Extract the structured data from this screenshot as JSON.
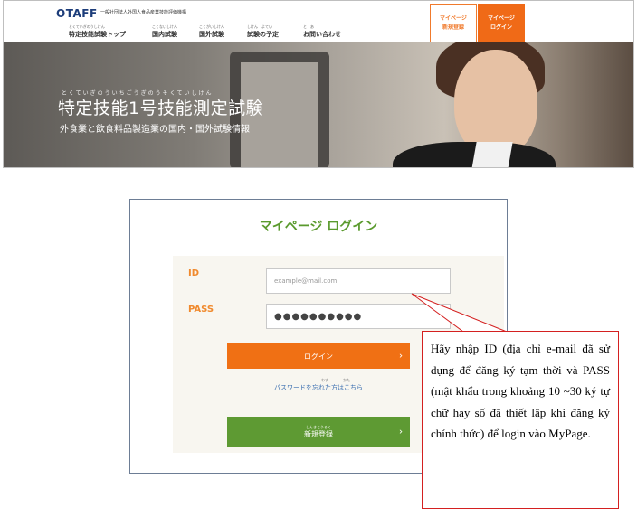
{
  "header": {
    "logo": "OTAFF",
    "org": "一般社団法人外国人食品産業技能評価機構",
    "nav": [
      {
        "ruby": "とくていぎのうしけん",
        "label": "特定技能試験トップ"
      },
      {
        "ruby": "こくないしけん",
        "label": "国内試験"
      },
      {
        "ruby": "こくがいしけん",
        "label": "国外試験"
      },
      {
        "ruby": "しけん　よてい",
        "label": "試験の予定"
      },
      {
        "ruby": "と　あ",
        "label": "お問い合わせ"
      }
    ],
    "register_button": [
      "マイページ",
      "新規登録"
    ],
    "login_button": [
      "マイページ",
      "ログイン"
    ]
  },
  "hero": {
    "ruby": "とくていぎのういちごうぎのうそくていしけん",
    "title": "特定技能1号技能測定試験",
    "subtitle": "外食業と飲食料品製造業の国内・国外試験情報"
  },
  "login": {
    "title": "マイページ ログイン",
    "id_label": "ID",
    "id_placeholder": "example@mail.com",
    "pass_label": "PASS",
    "pass_value": "●●●●●●●●●●",
    "login_button": "ログイン",
    "forgot_ruby": "わす　　　　かた",
    "forgot_link": "パスワードを忘れた方はこちら",
    "register_ruby": "しんきとうろく",
    "register_button": "新規登録",
    "chevron": "›"
  },
  "callout": {
    "text": "Hãy nhập ID (địa chỉ e-mail đã sử dụng để đăng ký tạm thời và PASS (mật khẩu trong khoảng 10 ~30 ký tự chữ hay số đã thiết lập khi đăng ký chính thức) để login vào MyPage."
  },
  "colors": {
    "brand_orange": "#f07014",
    "brand_green": "#5e9a33",
    "title_green": "#5a9a2d",
    "callout_red": "#d42020"
  }
}
